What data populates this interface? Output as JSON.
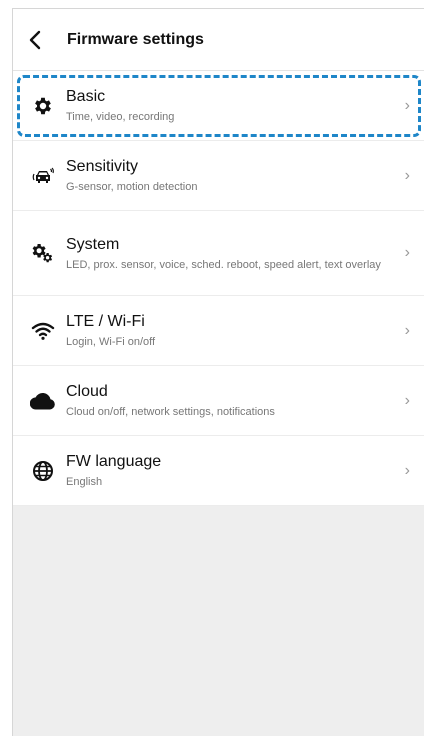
{
  "header": {
    "title": "Firmware settings"
  },
  "items": [
    {
      "title": "Basic",
      "subtitle": "Time, video, recording",
      "icon": "gear-icon"
    },
    {
      "title": "Sensitivity",
      "subtitle": "G-sensor, motion detection",
      "icon": "car-motion-icon"
    },
    {
      "title": "System",
      "subtitle": "LED, prox. sensor, voice, sched. reboot, speed alert, text overlay",
      "icon": "gears-icon"
    },
    {
      "title": "LTE / Wi-Fi",
      "subtitle": "Login, Wi-Fi on/off",
      "icon": "wifi-icon"
    },
    {
      "title": "Cloud",
      "subtitle": "Cloud on/off, network settings, notifications",
      "icon": "cloud-icon"
    },
    {
      "title": "FW language",
      "subtitle": "English",
      "icon": "globe-icon"
    }
  ],
  "colors": {
    "highlight": "#1e86c8",
    "background": "#eeeeee"
  }
}
